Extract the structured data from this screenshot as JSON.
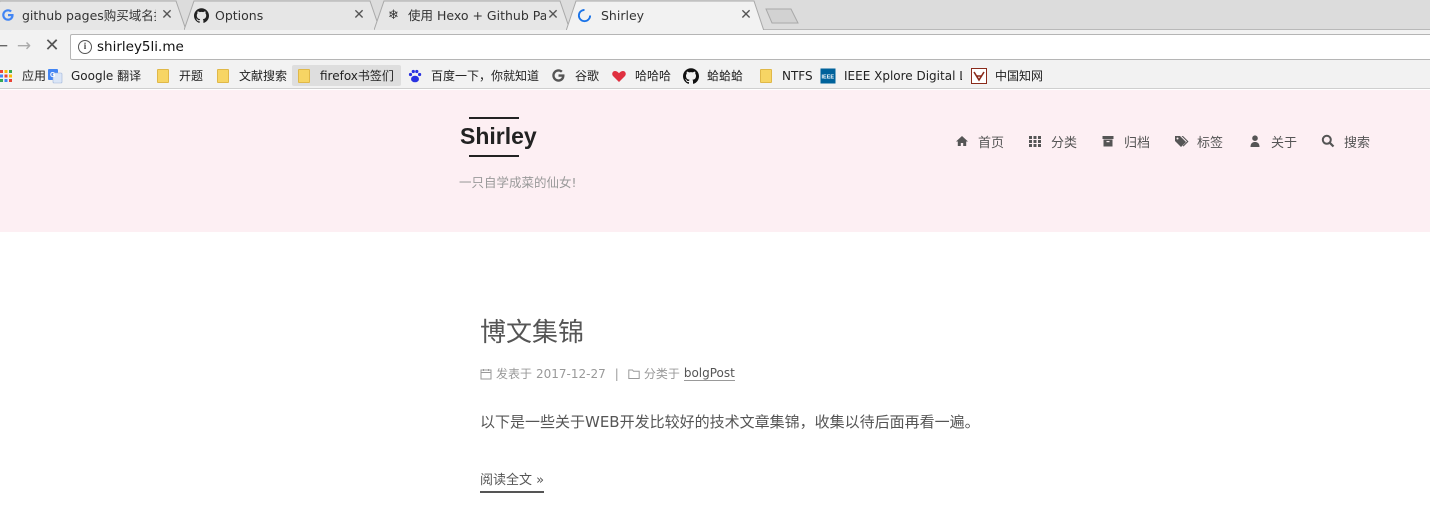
{
  "browser": {
    "tabs": [
      {
        "title": "github pages购买域名推",
        "icon": "google-g-icon"
      },
      {
        "title": "Options",
        "icon": "github-icon"
      },
      {
        "title": "使用 Hexo + Github Pa",
        "icon": "snowflake-icon"
      },
      {
        "title": "Shirley",
        "icon": "loading-spinner-icon",
        "active": true
      }
    ],
    "url": "shirley5li.me",
    "bookmarks": [
      {
        "label": "应用",
        "icon": "apps-grid-icon"
      },
      {
        "label": "Google 翻译",
        "icon": "google-translate-icon"
      },
      {
        "label": "开题",
        "icon": "folder-icon"
      },
      {
        "label": "文献搜索",
        "icon": "folder-icon"
      },
      {
        "label": "firefox书签们",
        "icon": "folder-icon"
      },
      {
        "label": "百度一下，你就知道",
        "icon": "baidu-paw-icon"
      },
      {
        "label": "谷歌",
        "icon": "google-g-icon"
      },
      {
        "label": "哈哈哈",
        "icon": "heart-icon"
      },
      {
        "label": "蛤蛤蛤",
        "icon": "github-icon"
      },
      {
        "label": "NTFS",
        "icon": "folder-icon"
      },
      {
        "label": "IEEE Xplore Digital L",
        "icon": "ieee-icon"
      },
      {
        "label": "中国知网",
        "icon": "cnki-icon"
      }
    ]
  },
  "site": {
    "title": "Shirley",
    "subtitle": "一只自学成菜的仙女!",
    "menu": [
      {
        "label": "首页",
        "icon": "home-icon"
      },
      {
        "label": "分类",
        "icon": "grid-icon"
      },
      {
        "label": "归档",
        "icon": "archive-icon"
      },
      {
        "label": "标签",
        "icon": "tags-icon"
      },
      {
        "label": "关于",
        "icon": "user-icon"
      },
      {
        "label": "搜索",
        "icon": "search-icon"
      }
    ]
  },
  "post": {
    "title": "博文集锦",
    "meta": {
      "published_label": "发表于",
      "date": "2017-12-27",
      "separator": "|",
      "category_label": "分类于",
      "category": "bolgPost"
    },
    "excerpt": "以下是一些关于WEB开发比较好的技术文章集锦，收集以待后面再看一遍。",
    "read_more": "阅读全文 »"
  }
}
